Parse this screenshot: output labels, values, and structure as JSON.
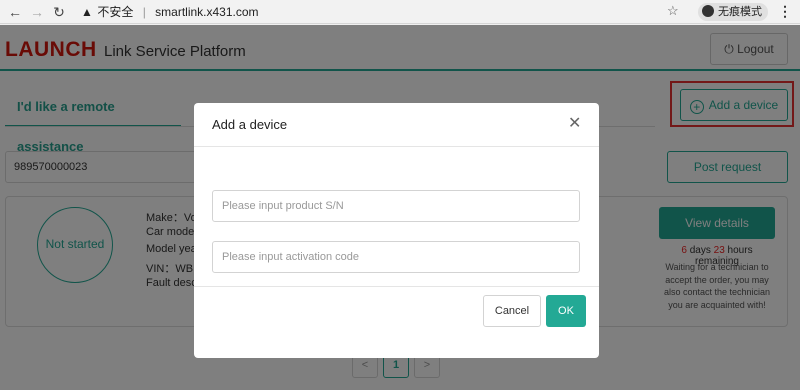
{
  "browser": {
    "back_icon": "back-arrow-icon",
    "forward_icon": "forward-arrow-icon",
    "reload_icon": "reload-icon",
    "security_label": "不安全",
    "url": "smartlink.x431.com",
    "incognito_label": "无痕模式"
  },
  "header": {
    "brand": "LAUNCH",
    "platform": "Link Service Platform",
    "logout_label": "Logout"
  },
  "tabs": {
    "remote_assistance": "I'd like a remote assistance"
  },
  "toolbar": {
    "add_device_label": "Add a device",
    "post_request_label": "Post request",
    "sn_value": "989570000023"
  },
  "order": {
    "status": "Not started",
    "make_label": "Make：Vo",
    "car_model_label": "Car mode",
    "model_year_label": "Model yea",
    "vin_label": "VIN：WB",
    "fault_label": "Fault desc",
    "view_details_label": "View details",
    "days": "6",
    "days_label": " days ",
    "hours": "23",
    "hours_remaining_label": " hours remaining",
    "waiting_text": "Waiting for a technician to accept the order, you may also contact the technician you are acquainted with!"
  },
  "pagination": {
    "prev": "<",
    "current": "1",
    "next": ">"
  },
  "modal": {
    "title": "Add a device",
    "close_icon": "close-icon",
    "sn_placeholder": "Please input product S/N",
    "activation_placeholder": "Please input activation code",
    "cancel_label": "Cancel",
    "ok_label": "OK"
  },
  "colors": {
    "accent": "#23a995",
    "brand_red": "#d3160c",
    "highlight_red": "#e63131",
    "remaining_red": "#e22222"
  }
}
